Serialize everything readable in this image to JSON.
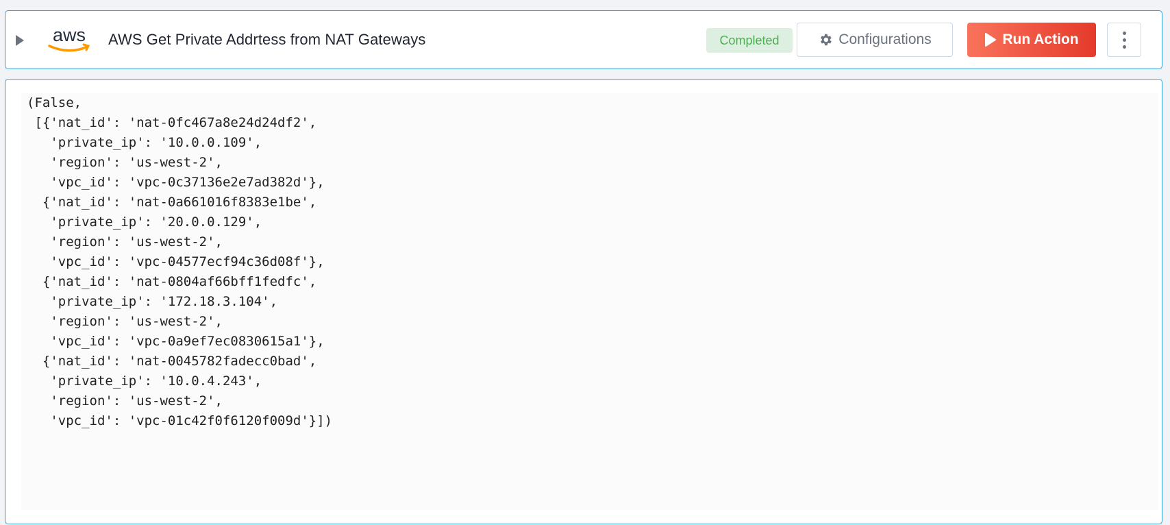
{
  "header": {
    "logo_text": "aws",
    "title": "AWS Get Private Addrtess from NAT Gateways",
    "status": "Completed",
    "configurations_label": "Configurations",
    "run_label": "Run Action",
    "colors": {
      "accent": "#3b9ad9",
      "run_start": "#f9735b",
      "run_end": "#e53a2b",
      "status_bg": "#dcefe0",
      "status_text": "#4caf50"
    }
  },
  "output": {
    "lines": [
      "(False,",
      " [{'nat_id': 'nat-0fc467a8e24d24df2',",
      "   'private_ip': '10.0.0.109',",
      "   'region': 'us-west-2',",
      "   'vpc_id': 'vpc-0c37136e2e7ad382d'},",
      "  {'nat_id': 'nat-0a661016f8383e1be',",
      "   'private_ip': '20.0.0.129',",
      "   'region': 'us-west-2',",
      "   'vpc_id': 'vpc-04577ecf94c36d08f'},",
      "  {'nat_id': 'nat-0804af66bff1fedfc',",
      "   'private_ip': '172.18.3.104',",
      "   'region': 'us-west-2',",
      "   'vpc_id': 'vpc-0a9ef7ec0830615a1'},",
      "  {'nat_id': 'nat-0045782fadecc0bad',",
      "   'private_ip': '10.0.4.243',",
      "   'region': 'us-west-2',",
      "   'vpc_id': 'vpc-01c42f0f6120f009d'}])"
    ]
  }
}
